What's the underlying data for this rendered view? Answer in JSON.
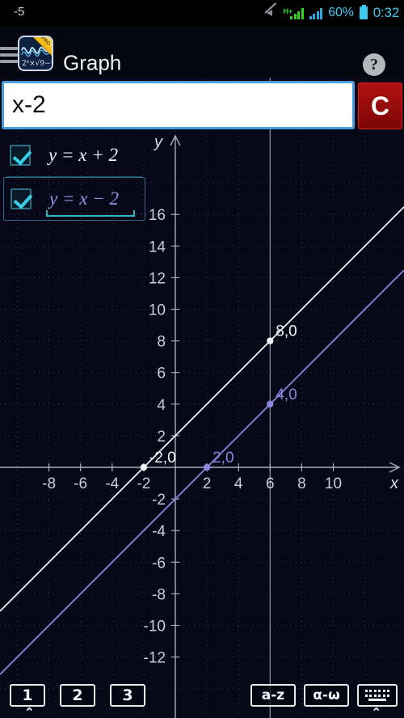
{
  "statusbar": {
    "note": "-5",
    "network_type": "H+",
    "battery_percent": "60%",
    "clock": "0:32",
    "icons": [
      "mute-icon",
      "signal-hplus-icon",
      "signal-icon",
      "battery-icon"
    ]
  },
  "titlebar": {
    "title": "Graph",
    "app_icon_expression": "2ᵟ×√9−³⁄₂",
    "app_icon_badge": "PRO",
    "help_label": "?"
  },
  "input": {
    "value": "x-2",
    "placeholder": "",
    "clear_label": "C"
  },
  "equations": [
    {
      "label": "y = x + 2",
      "checked": true,
      "color": "#f0f2f5",
      "selected": false
    },
    {
      "label": "y = x − 2",
      "checked": true,
      "color": "#9b93e8",
      "selected": true
    }
  ],
  "toolbar": {
    "number_buttons": [
      "1",
      "2",
      "3"
    ],
    "alpha_latin": "a-z",
    "alpha_greek": "α-ω",
    "keyboard_icon": "keyboard-icon",
    "chevron": "⌃"
  },
  "chart_data": {
    "type": "line",
    "title": "",
    "xlabel": "x",
    "ylabel": "y",
    "xlim": [
      -9.4,
      11.6
    ],
    "ylim": [
      -12.8,
      17.8
    ],
    "xticks": [
      -8,
      -6,
      -4,
      -2,
      2,
      4,
      6,
      8,
      10
    ],
    "yticks": [
      16,
      14,
      12,
      10,
      8,
      6,
      4,
      2,
      -2,
      -4,
      -6,
      -8,
      -10,
      -12
    ],
    "grid": true,
    "grid_style": "dotted",
    "background": "#070718",
    "axis_color": "#9aa0b0",
    "tracer_x": 6,
    "tracer_label": "6",
    "series": [
      {
        "name": "y = x + 2",
        "color": "#f0f2f5",
        "slope": 1,
        "intercept": 2,
        "points": [
          {
            "x": -2,
            "y": 0,
            "label": "-2,0"
          },
          {
            "x": 6,
            "y": 8,
            "label": "8,0"
          }
        ]
      },
      {
        "name": "y = x - 2",
        "color": "#8d86e0",
        "slope": 1,
        "intercept": -2,
        "points": [
          {
            "x": 2,
            "y": 0,
            "label": "2,0"
          },
          {
            "x": 6,
            "y": 4,
            "label": "4,0"
          }
        ]
      }
    ]
  }
}
